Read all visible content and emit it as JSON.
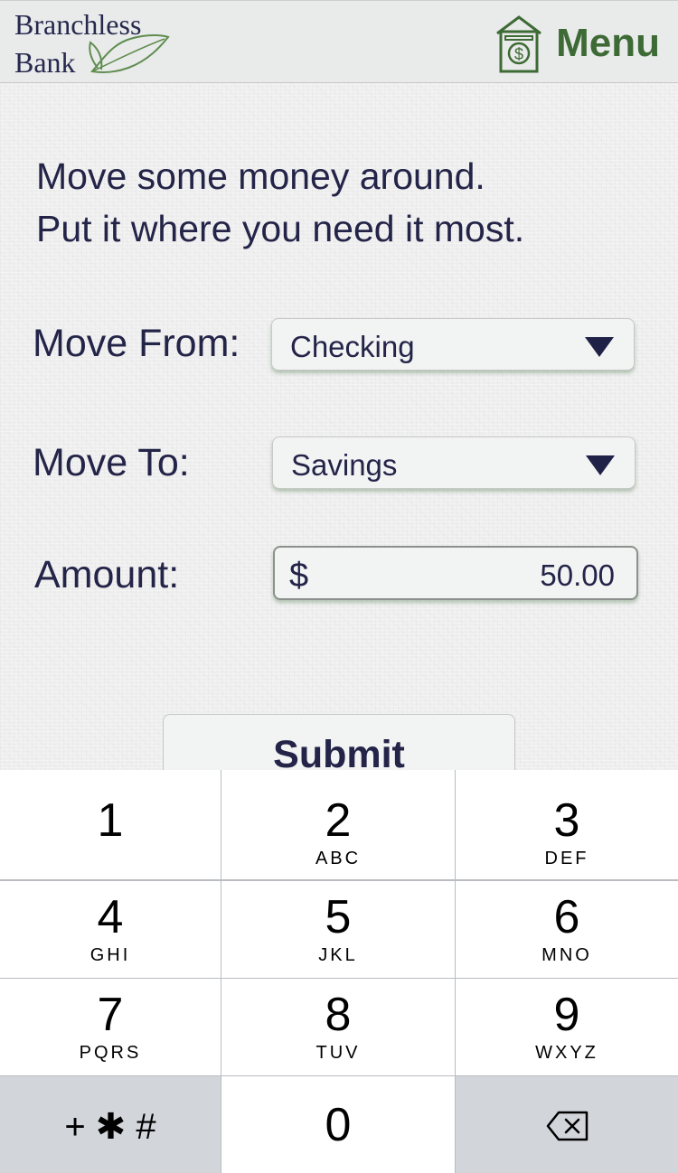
{
  "header": {
    "logo_line1": "Branchless",
    "logo_line2": "Bank",
    "menu_label": "Menu",
    "menu_icon": "house-dollar-icon"
  },
  "headline": {
    "line1": "Move some money around.",
    "line2": "Put it where you need it most."
  },
  "form": {
    "from_label": "Move From:",
    "from_value": "Checking",
    "to_label": "Move To:",
    "to_value": "Savings",
    "amount_label": "Amount:",
    "amount_currency": "$",
    "amount_value": "50.00",
    "submit_label": "Submit"
  },
  "keypad": {
    "keys": [
      {
        "digit": "1",
        "letters": ""
      },
      {
        "digit": "2",
        "letters": "ABC"
      },
      {
        "digit": "3",
        "letters": "DEF"
      },
      {
        "digit": "4",
        "letters": "GHI"
      },
      {
        "digit": "5",
        "letters": "JKL"
      },
      {
        "digit": "6",
        "letters": "MNO"
      },
      {
        "digit": "7",
        "letters": "PQRS"
      },
      {
        "digit": "8",
        "letters": "TUV"
      },
      {
        "digit": "9",
        "letters": "WXYZ"
      }
    ],
    "symbols": "+ ✱ #",
    "zero": "0",
    "delete_icon": "backspace-icon"
  },
  "colors": {
    "brand_green": "#3e6b35",
    "text_navy": "#232448",
    "keypad_dark": "#d2d5da"
  }
}
